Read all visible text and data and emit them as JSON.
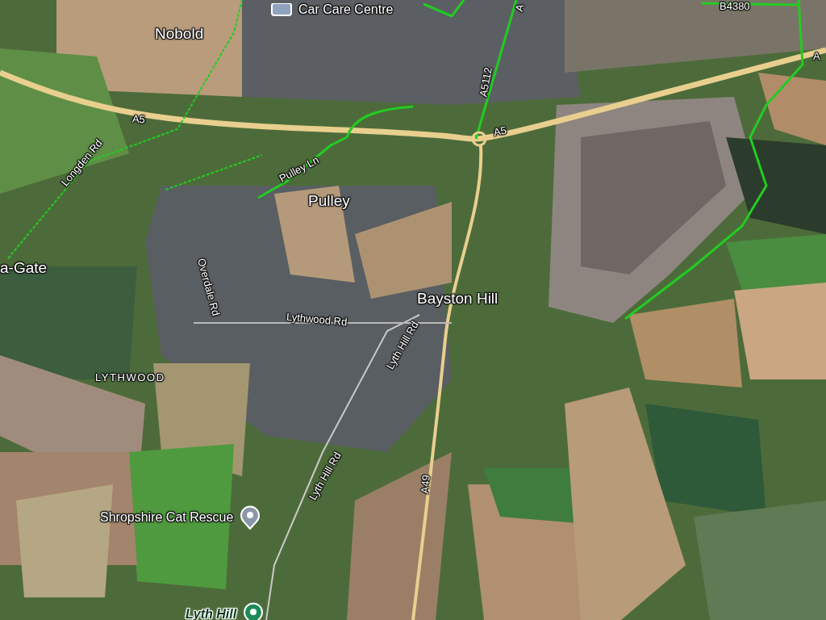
{
  "map_labels": [
    {
      "kind": "shop",
      "text": "Car Care Centre"
    },
    {
      "kind": "road",
      "text": "B4380"
    },
    {
      "kind": "road",
      "text": "A"
    },
    {
      "kind": "road",
      "text": "A"
    },
    {
      "kind": "place",
      "text": "Nobold"
    },
    {
      "kind": "road",
      "text": "A5112"
    },
    {
      "kind": "road",
      "text": "A5"
    },
    {
      "kind": "road",
      "text": "A5"
    },
    {
      "kind": "road",
      "text": "Longden Rd"
    },
    {
      "kind": "road",
      "text": "Pulley Ln"
    },
    {
      "kind": "place",
      "text": "Pulley"
    },
    {
      "kind": "place",
      "text": "a-Gate"
    },
    {
      "kind": "road",
      "text": "Overdale Rd"
    },
    {
      "kind": "place",
      "text": "Bayston Hill"
    },
    {
      "kind": "road",
      "text": "Lythwood Rd"
    },
    {
      "kind": "road",
      "text": "Lyth Hill Rd"
    },
    {
      "kind": "area",
      "text": "LYTHWOOD"
    },
    {
      "kind": "road",
      "text": "Lyth Hill Rd"
    },
    {
      "kind": "road",
      "text": "A49"
    },
    {
      "kind": "poi",
      "text": "Shropshire Cat Rescue"
    },
    {
      "kind": "park",
      "text": "Lyth Hill"
    }
  ]
}
